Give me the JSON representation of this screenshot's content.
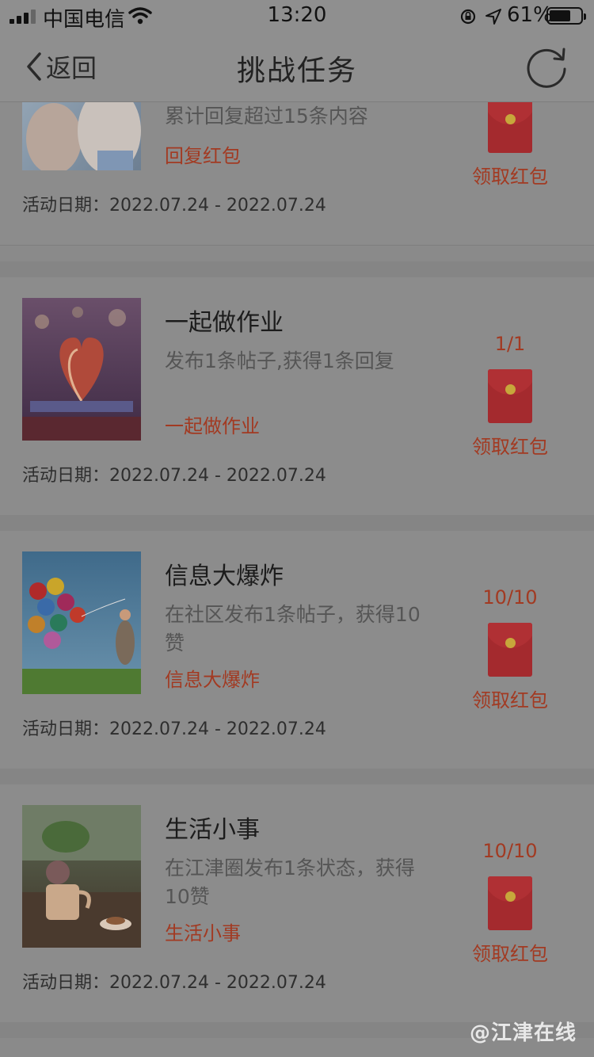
{
  "status_bar": {
    "carrier": "中国电信",
    "time": "13:20",
    "battery": "61%"
  },
  "nav": {
    "back_label": "返回",
    "title": "挑战任务"
  },
  "tasks": [
    {
      "title": "",
      "desc": "累计回复超过15条内容",
      "tag": "回复红包",
      "date": "活动日期：2022.07.24 - 2022.07.24",
      "progress": "",
      "claim": "领取红包"
    },
    {
      "title": "一起做作业",
      "desc": "发布1条帖子,获得1条回复",
      "tag": "一起做作业",
      "date": "活动日期：2022.07.24 - 2022.07.24",
      "progress": "1/1",
      "claim": "领取红包"
    },
    {
      "title": "信息大爆炸",
      "desc": "在社区发布1条帖子，获得10赞",
      "tag": "信息大爆炸",
      "date": "活动日期：2022.07.24 - 2022.07.24",
      "progress": "10/10",
      "claim": "领取红包"
    },
    {
      "title": "生活小事",
      "desc": "在江津圈发布1条状态，获得10赞",
      "tag": "生活小事",
      "date": "活动日期：2022.07.24 - 2022.07.24",
      "progress": "10/10",
      "claim": "领取红包"
    }
  ],
  "watermark": "@江津在线"
}
